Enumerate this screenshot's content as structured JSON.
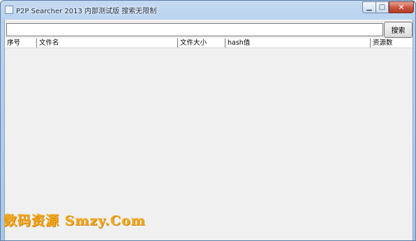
{
  "window": {
    "title": "P2P Searcher 2013 内部测试版 搜索无限制",
    "controls": {
      "minimize": "▁",
      "maximize": "□",
      "close": "✕"
    }
  },
  "search": {
    "value": "",
    "placeholder": "",
    "button_label": "搜索"
  },
  "list": {
    "columns": [
      "序号",
      "文件名",
      "文件大小",
      "hash值",
      "资源数"
    ],
    "rows": []
  },
  "watermark": "数码资源 Smzy.Com"
}
